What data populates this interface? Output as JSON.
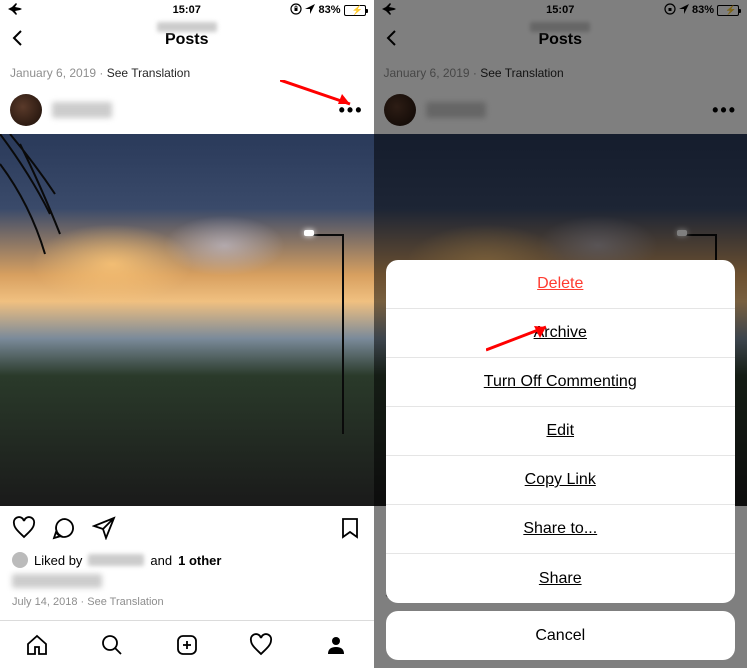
{
  "statusbar": {
    "time": "15:07",
    "battery_pct": "83%",
    "airplane_icon": "airplane",
    "wifi_icon": "wifi",
    "orientation_lock_icon": "orientation-lock",
    "location_icon": "location"
  },
  "nav": {
    "title": "Posts"
  },
  "top_meta": {
    "date": "January 6, 2019",
    "separator": "·",
    "translate": "See Translation"
  },
  "post": {
    "more": "•••"
  },
  "likes": {
    "prefix": "Liked by",
    "middle": "and",
    "other": "1 other"
  },
  "bottom_meta": {
    "date": "July 14, 2018",
    "separator": "·",
    "translate": "See Translation"
  },
  "sheet": {
    "items": [
      {
        "label": "Delete",
        "destructive": true
      },
      {
        "label": "Archive",
        "destructive": false
      },
      {
        "label": "Turn Off Commenting",
        "destructive": false
      },
      {
        "label": "Edit",
        "destructive": false
      },
      {
        "label": "Copy Link",
        "destructive": false
      },
      {
        "label": "Share to...",
        "destructive": false
      },
      {
        "label": "Share",
        "destructive": false
      }
    ],
    "cancel": "Cancel"
  },
  "annotation": {
    "arrow_color": "#ff0000"
  }
}
